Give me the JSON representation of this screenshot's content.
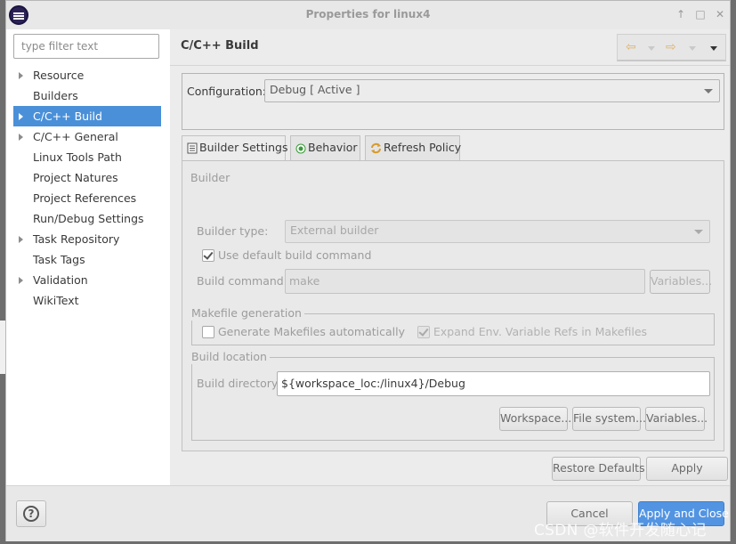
{
  "window": {
    "title": "Properties for linux4"
  },
  "filter": {
    "placeholder": "type filter text"
  },
  "tree": [
    {
      "label": "Resource",
      "expandable": true
    },
    {
      "label": "Builders",
      "expandable": false
    },
    {
      "label": "C/C++ Build",
      "expandable": true,
      "selected": true
    },
    {
      "label": "C/C++ General",
      "expandable": true
    },
    {
      "label": "Linux Tools Path",
      "expandable": false
    },
    {
      "label": "Project Natures",
      "expandable": false
    },
    {
      "label": "Project References",
      "expandable": false
    },
    {
      "label": "Run/Debug Settings",
      "expandable": false
    },
    {
      "label": "Task Repository",
      "expandable": true
    },
    {
      "label": "Task Tags",
      "expandable": false
    },
    {
      "label": "Validation",
      "expandable": true
    },
    {
      "label": "WikiText",
      "expandable": false
    }
  ],
  "page": {
    "title": "C/C++ Build"
  },
  "configuration": {
    "label": "Configuration:",
    "value": "Debug  [ Active ]"
  },
  "tabs": [
    {
      "label": "Builder Settings",
      "icon": "builder-icon"
    },
    {
      "label": "Behavior",
      "icon": "behavior-icon"
    },
    {
      "label": "Refresh Policy",
      "icon": "refresh-icon"
    }
  ],
  "builder": {
    "group_label": "Builder",
    "type_label": "Builder type:",
    "type_value": "External builder",
    "use_default_label": "Use default build command",
    "use_default_checked": true,
    "command_label": "Build command:",
    "command_value": "make",
    "variables_label": "Variables..."
  },
  "makefile": {
    "group_label": "Makefile generation",
    "generate_label": "Generate Makefiles automatically",
    "generate_checked": false,
    "expand_label": "Expand Env. Variable Refs in Makefiles",
    "expand_checked": true
  },
  "location": {
    "group_label": "Build location",
    "dir_label": "Build directory:",
    "dir_value": "${workspace_loc:/linux4}/Debug",
    "workspace_label": "Workspace...",
    "filesystem_label": "File system...",
    "variables_label": "Variables..."
  },
  "buttons": {
    "restore_defaults": "Restore Defaults",
    "apply": "Apply",
    "cancel": "Cancel",
    "apply_close": "Apply and Close"
  },
  "watermark": "CSDN @软件开发随心记",
  "colors": {
    "selection": "#4a90d9",
    "primary_button": "#5294e2"
  }
}
